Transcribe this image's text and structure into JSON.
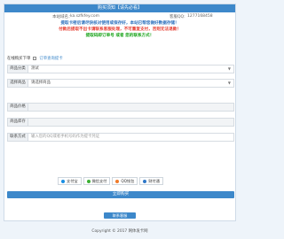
{
  "header": {
    "title": "购买须知【请先必看】"
  },
  "info": {
    "site_label": "本站域名：",
    "site_value": "ka.szfkfey.com",
    "qq_label": "客服QQ:",
    "qq_value": "1277168458"
  },
  "notices": [
    "提取卡密后请尽快核对使用或保存好，本站已帮您做好数据存储！",
    "付款后提取不出卡请联系客服处理，不可重复支付，否则无法退款！",
    "提取码即订单号 或者 您的联系方式！"
  ],
  "pay_option": {
    "label": "在线购买下单",
    "link": "订单查询提卡"
  },
  "fields": {
    "category": {
      "label": "商品分类",
      "value": "测试"
    },
    "product": {
      "label": "选择商品",
      "value": "请选择商品"
    },
    "price": {
      "label": "商品价格",
      "value": ""
    },
    "stock": {
      "label": "商品库存",
      "value": ""
    },
    "contact": {
      "label": "联系方式",
      "placeholder": "输入您的QQ或者手机号码作为提卡凭证"
    }
  },
  "methods": [
    {
      "label": "支付宝",
      "color": "#1a8fe3"
    },
    {
      "label": "微信支付",
      "color": "#3cb034"
    },
    {
      "label": "QQ钱包",
      "color": "#f07b2a"
    },
    {
      "label": "财付通",
      "color": "#2f78c8"
    }
  ],
  "submit_label": "立即购买",
  "footer_button": "联系客服",
  "copyright": "Copyright © 2017 网体发卡网"
}
